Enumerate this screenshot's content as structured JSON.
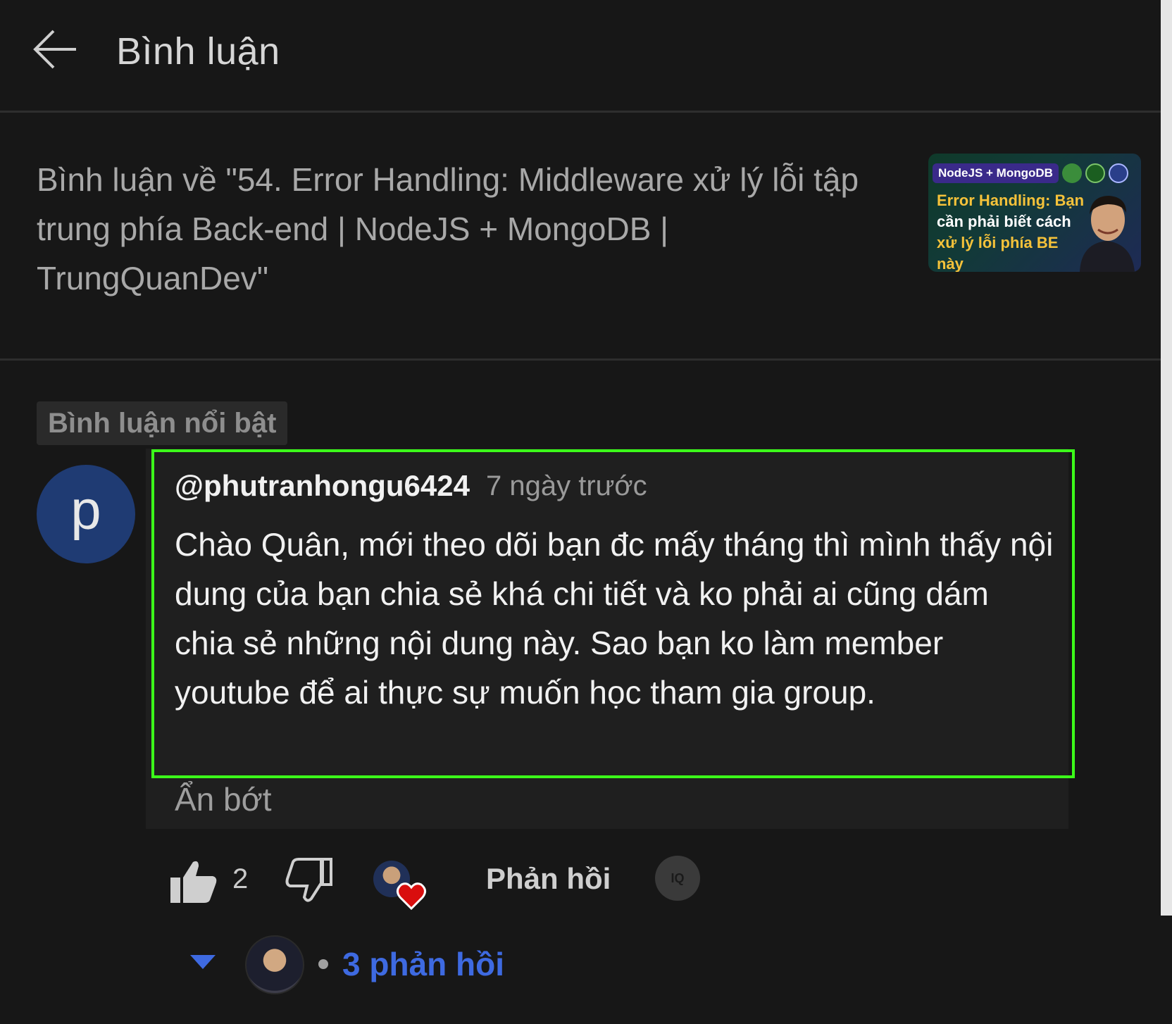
{
  "header": {
    "title": "Bình luận"
  },
  "video": {
    "title": "Bình luận về \"54. Error Handling: Middleware xử lý lỗi tập trung phía Back-end | NodeJS + MongoDB | TrungQuanDev\"",
    "thumbnail": {
      "tag": "NodeJS + MongoDB",
      "line1": "Error Handling: Bạn",
      "line2": "cần phải biết cách",
      "line3": "xử lý lỗi phía BE này"
    }
  },
  "filter_chip": "Bình luận nổi bật",
  "comment": {
    "avatar_letter": "p",
    "author": "@phutranhongu6424",
    "time": "7 ngày trước",
    "body": "Chào Quân, mới theo dõi bạn đc mấy tháng thì mình thấy nội dung của bạn chia sẻ khá chi tiết và ko phải ai cũng dám chia sẻ những nội dung này. Sao bạn ko làm member youtube để ai thực sự muốn học tham gia group.",
    "show_less": "Ẩn bớt",
    "likes": "2",
    "reply_label": "Phản hồi",
    "iq_label": "IQ"
  },
  "replies": {
    "count_label": "3 phản hồi"
  },
  "colors": {
    "background": "#171717",
    "highlight_border": "#3cff1a",
    "link_blue": "#3e6ae1",
    "avatar_blue": "#1f3b73"
  },
  "icons": {
    "back": "arrow-left-icon",
    "like": "thumbs-up-icon",
    "dislike": "thumbs-down-icon",
    "heart": "heart-icon",
    "expand": "caret-down-icon"
  }
}
